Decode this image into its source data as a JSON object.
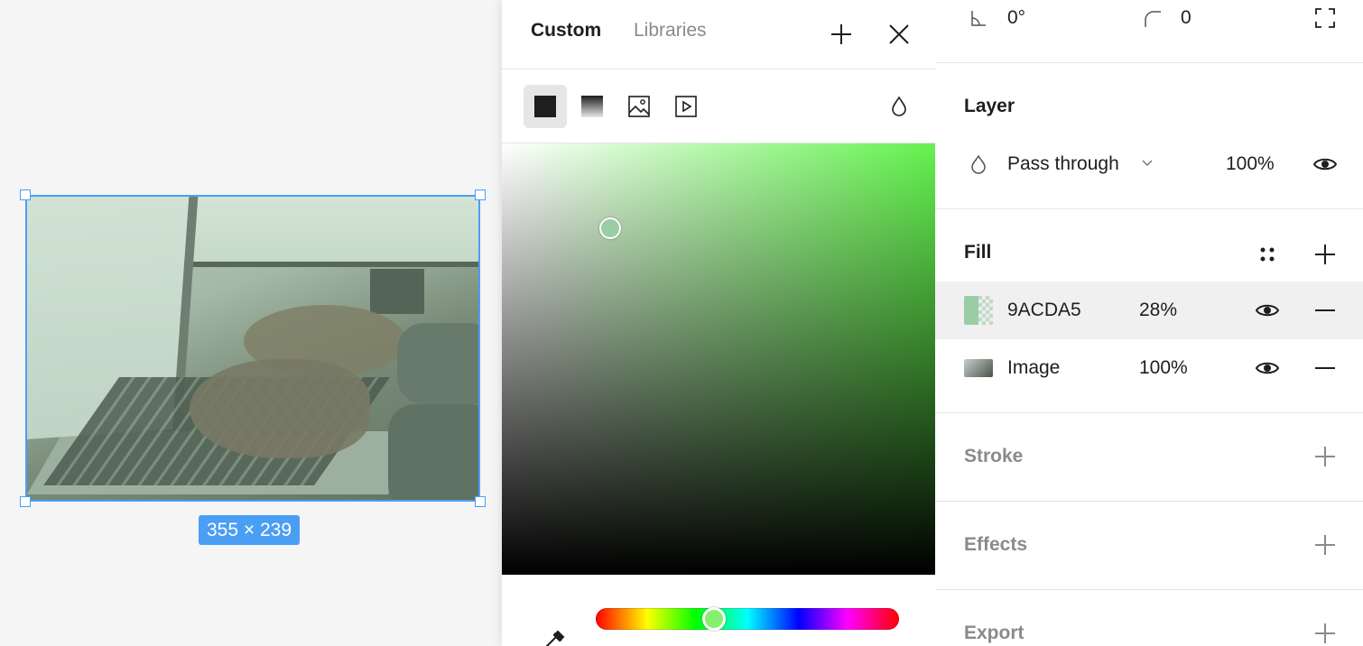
{
  "canvas": {
    "selection_size": "355 × 239"
  },
  "picker": {
    "tabs": [
      "Custom",
      "Libraries"
    ],
    "fill_types": [
      "solid-fill",
      "gradient-fill",
      "image-fill",
      "video-fill"
    ],
    "current_color": "#9ACDA5",
    "hue_color": "#64F24E"
  },
  "panel": {
    "rotation": "0°",
    "corner_radius": "0",
    "layer": {
      "title": "Layer",
      "blend_mode": "Pass through",
      "opacity": "100%"
    },
    "fill": {
      "title": "Fill",
      "items": [
        {
          "label": "9ACDA5",
          "opacity": "28%",
          "swatch": "#9ACDA5"
        },
        {
          "label": "Image",
          "opacity": "100%"
        }
      ]
    },
    "stroke": {
      "title": "Stroke"
    },
    "effects": {
      "title": "Effects"
    },
    "export": {
      "title": "Export"
    }
  }
}
